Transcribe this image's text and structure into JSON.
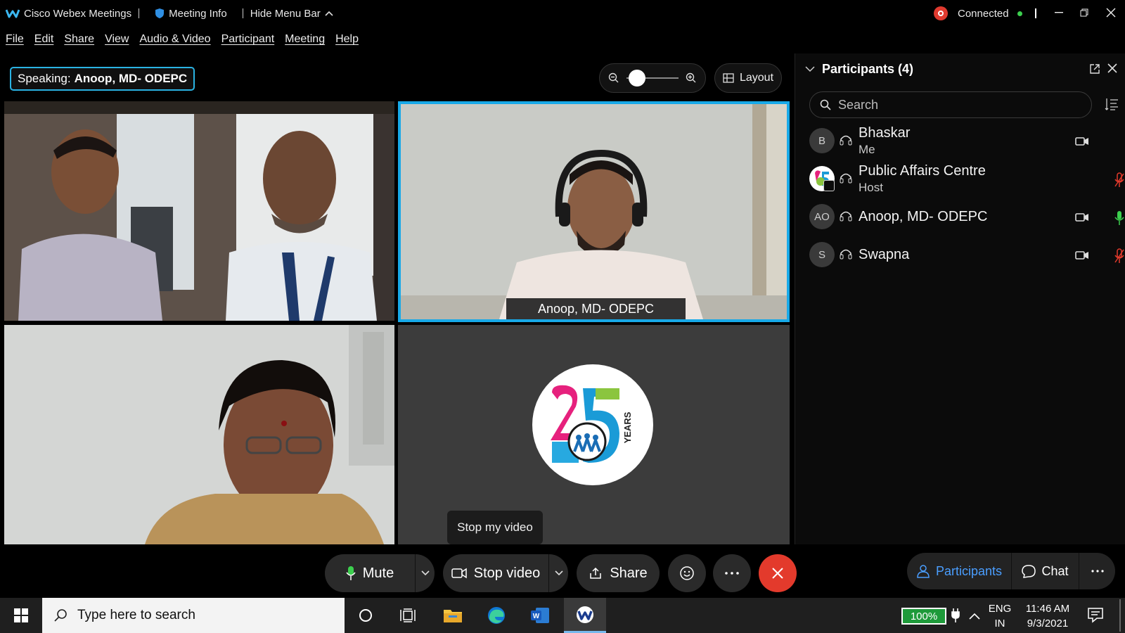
{
  "window": {
    "app_title": "Cisco Webex Meetings",
    "meeting_info": "Meeting Info",
    "hide_menu_bar": "Hide Menu Bar",
    "status": "Connected",
    "status_color": "#3ccf4e",
    "record_color": "#e03a2f"
  },
  "menu": {
    "items": [
      "File",
      "Edit",
      "Share",
      "View",
      "Audio & Video",
      "Participant",
      "Meeting",
      "Help"
    ]
  },
  "stage": {
    "speaking_prefix": "Speaking:",
    "speaking_name": "Anoop, MD- ODEPC",
    "layout_label": "Layout",
    "zoom_level": 0.1,
    "active_border_color": "#18a9e8",
    "tiles": [
      {
        "label": ""
      },
      {
        "label": "Anoop, MD- ODEPC"
      },
      {
        "label": ""
      },
      {
        "label": ""
      }
    ],
    "logo_text": "25",
    "logo_subtext": "YEARS",
    "tooltip": "Stop my video"
  },
  "controls": {
    "mute": "Mute",
    "stop_video": "Stop video",
    "share": "Share",
    "leave_color": "#e33a2c"
  },
  "panel": {
    "title": "Participants (4)",
    "search_placeholder": "Search",
    "participants": [
      {
        "initials": "B",
        "name": "Bhaskar",
        "role": "Me",
        "camera": true,
        "mic": "none"
      },
      {
        "initials": "",
        "name": "Public Affairs Centre",
        "role": "Host",
        "camera": false,
        "mic": "muted"
      },
      {
        "initials": "AO",
        "name": "Anoop, MD- ODEPC",
        "role": "",
        "camera": true,
        "mic": "active"
      },
      {
        "initials": "S",
        "name": "Swapna",
        "role": "",
        "camera": true,
        "mic": "muted"
      }
    ],
    "tab_participants": "Participants",
    "tab_chat": "Chat",
    "accent_color": "#4a9eff"
  },
  "taskbar": {
    "search_placeholder": "Type here to search",
    "battery": "100%",
    "lang_line1": "ENG",
    "lang_line2": "IN",
    "time": "11:46 AM",
    "date": "9/3/2021"
  }
}
